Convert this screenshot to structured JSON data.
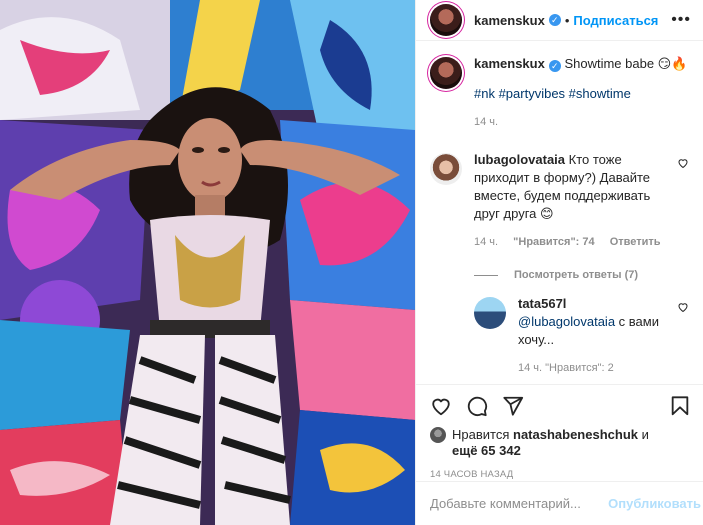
{
  "post": {
    "author": "kamenskux",
    "follow_label": "Подписаться",
    "dot": "•",
    "more_label": "•••"
  },
  "caption": {
    "username": "kamenskux",
    "text": "Showtime babe 😏🔥",
    "hashtags": "#nk #partyvibes #showtime",
    "time": "14 ч."
  },
  "comment1": {
    "username": "lubagolovataia",
    "text": "Кто тоже приходит в форму?) Давайте вместе, будем поддерживать друг друга 😊",
    "time": "14 ч.",
    "likes": "\"Нравится\": 74",
    "reply_label": "Ответить"
  },
  "view_replies": "Посмотреть ответы (7)",
  "reply1": {
    "username": "tata567l",
    "mention": "@lubagolovataia",
    "text": "с вами хочу...",
    "meta_partial": "14 ч.   \"Нравится\": 2"
  },
  "likes_line": {
    "prefix": "Нравится",
    "user": "natashabeneshchuk",
    "and": "и",
    "others": "ещё 65 342"
  },
  "timestamp": "14 ЧАСОВ НАЗАД",
  "composer": {
    "placeholder": "Добавьте комментарий...",
    "publish_label": "Опубликовать"
  },
  "colors": {
    "link_blue": "#0095f6",
    "verified": "#3897f0",
    "muted": "#8e8e8e",
    "hashtag": "#00376b",
    "publish_disabled": "#b2dffc"
  },
  "icons": [
    "heart-icon",
    "comment-icon",
    "share-icon",
    "bookmark-icon",
    "verified-icon",
    "more-icon"
  ]
}
